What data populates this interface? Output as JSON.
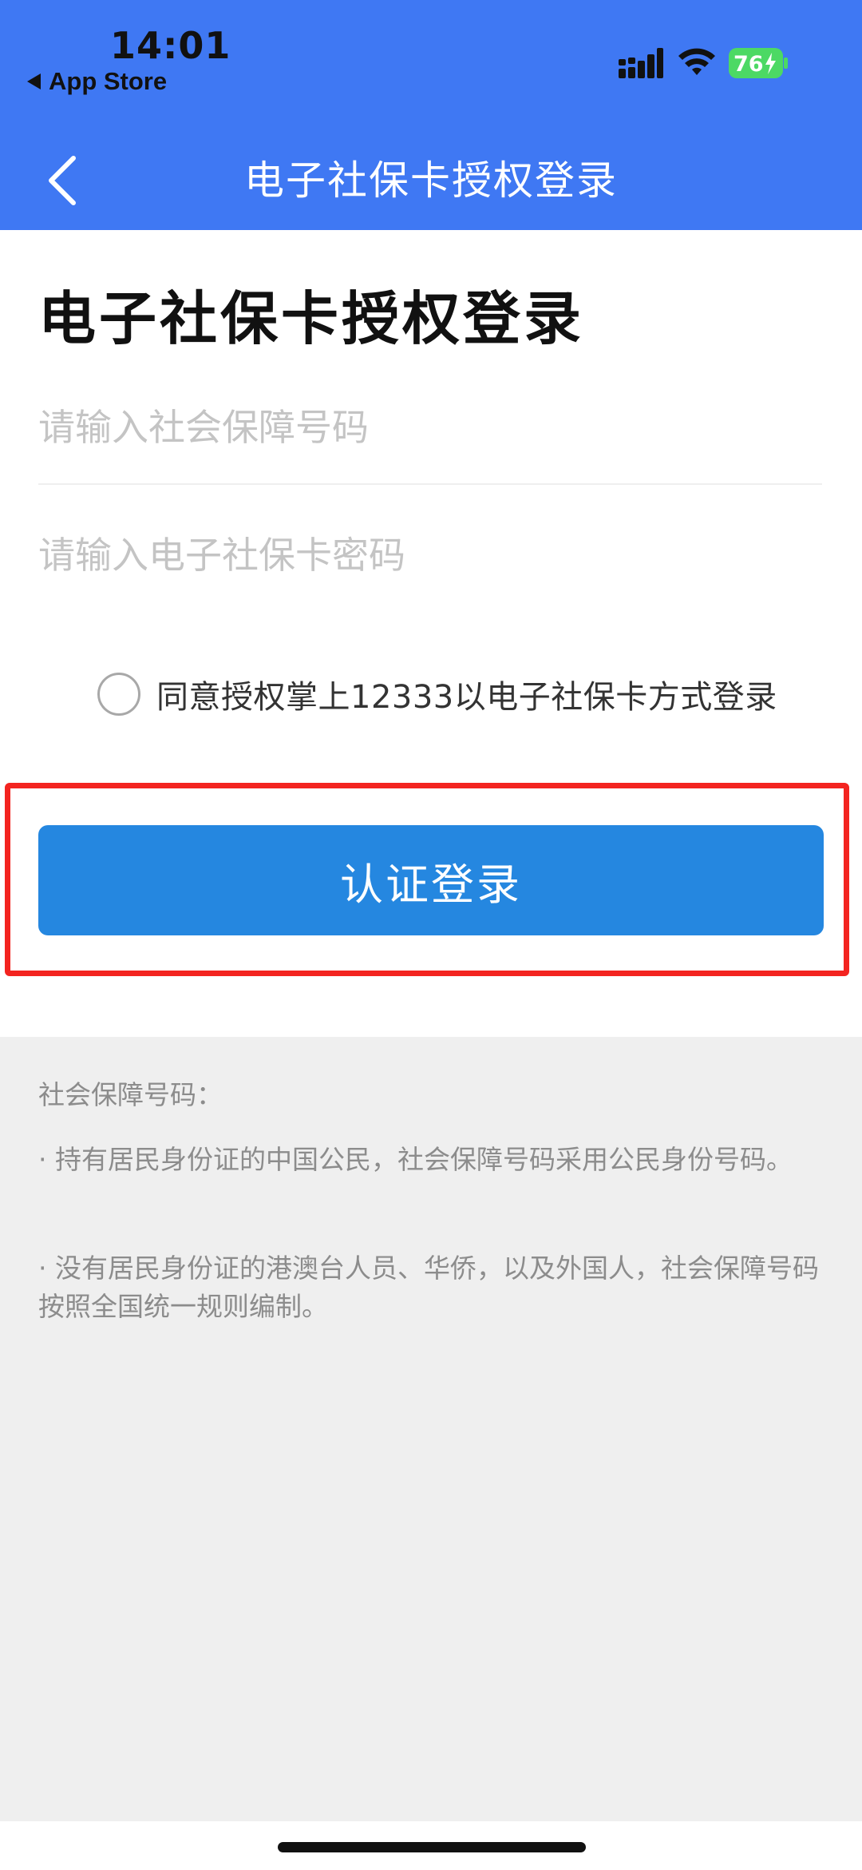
{
  "status_bar": {
    "time": "14:01",
    "back_app": "App Store",
    "battery_level": "76",
    "battery_color": "#4cd964"
  },
  "nav": {
    "title": "电子社保卡授权登录",
    "back_icon": "chevron-left-icon"
  },
  "form": {
    "title": "电子社保卡授权登录",
    "ssn_placeholder": "请输入社会保障号码",
    "ssn_value": "",
    "password_placeholder": "请输入电子社保卡密码",
    "password_value": "",
    "agree_label": "同意授权掌上12333以电子社保卡方式登录",
    "agree_checked": false,
    "submit_label": "认证登录"
  },
  "info": {
    "heading": "社会保障号码：",
    "notes": [
      "· 持有居民身份证的中国公民，社会保障号码采用公民身份号码。",
      "· 没有居民身份证的港澳台人员、华侨，以及外国人，社会保障号码按照全国统一规则编制。"
    ]
  },
  "colors": {
    "header_blue": "#3f78f3",
    "button_blue": "#2587e0",
    "highlight_red": "#f32420",
    "info_bg": "#efefef"
  }
}
